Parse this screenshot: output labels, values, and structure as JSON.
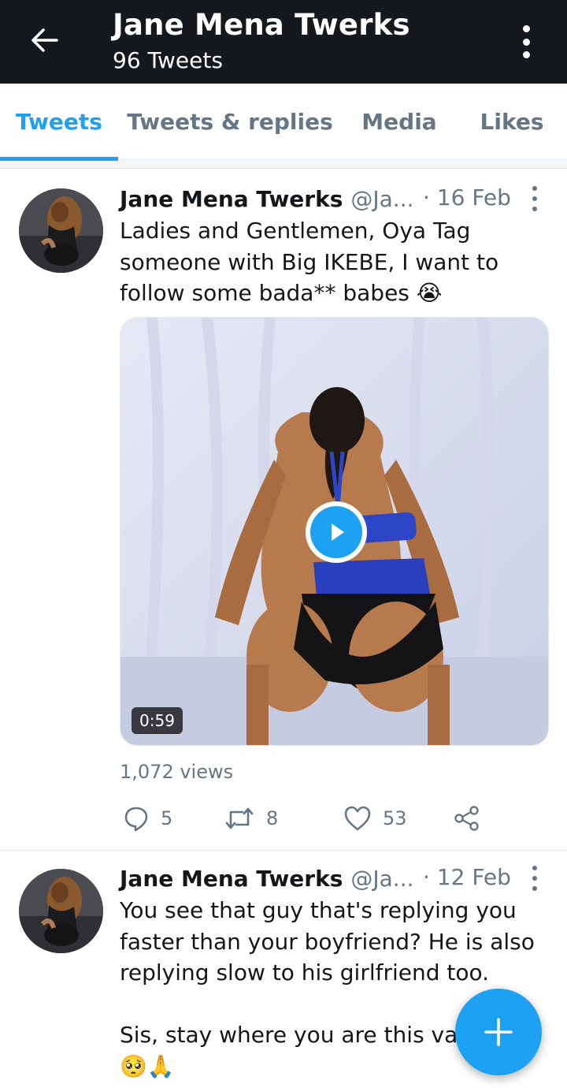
{
  "header": {
    "title": "Jane Mena Twerks",
    "subtitle": "96 Tweets"
  },
  "tabs": [
    {
      "label": "Tweets",
      "active": true
    },
    {
      "label": "Tweets & replies",
      "active": false
    },
    {
      "label": "Media",
      "active": false
    },
    {
      "label": "Likes",
      "active": false
    }
  ],
  "tweets": [
    {
      "name": "Jane Mena Twerks",
      "handle": "@Ja...",
      "date": "· 16 Feb",
      "text": "Ladies and Gentlemen, Oya Tag\nsomeone with Big IKEBE, I want to\nfollow some bada** babes 😭",
      "media": {
        "type": "video",
        "duration": "0:59"
      },
      "views": "1,072 views",
      "replies": "5",
      "retweets": "8",
      "likes": "53"
    },
    {
      "name": "Jane Mena Twerks",
      "handle": "@Ja...",
      "date": "· 12 Feb",
      "text": "You see that guy that's replying you\nfaster than your boyfriend? He is also\nreplying slow to his girlfriend too.\n\nSis, stay where you are this vale\n🥺🙏"
    }
  ],
  "colors": {
    "accent": "#1da1f2",
    "header_bg": "#15181c",
    "muted": "#657786"
  },
  "icons": {
    "back": "arrow-left-icon",
    "menu": "vertical-dots-icon",
    "reply": "comment-icon",
    "retweet": "retweet-icon",
    "like": "heart-icon",
    "share": "share-icon",
    "compose": "plus-icon",
    "play": "play-icon"
  }
}
